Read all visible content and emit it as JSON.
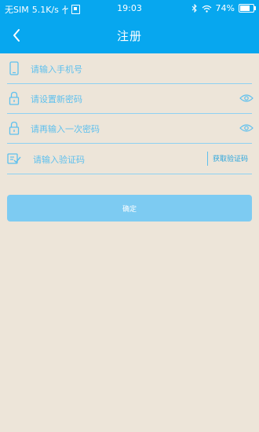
{
  "status_bar": {
    "carrier": "无SIM",
    "speed": "5.1K/s",
    "time": "19:03",
    "battery": "74%"
  },
  "nav": {
    "title": "注册"
  },
  "form": {
    "phone_placeholder": "请输入手机号",
    "password_placeholder": "请设置新密码",
    "confirm_placeholder": "请再输入一次密码",
    "code_placeholder": "请输入验证码",
    "get_code_label": "获取验证码",
    "submit_label": "确定"
  },
  "colors": {
    "header": "#07a7ef",
    "background": "#ede5d9",
    "accent": "#5ec0ee",
    "button": "#7dcbf2"
  },
  "icons": {
    "back": "back-arrow-icon",
    "phone": "phone-icon",
    "lock": "lock-icon",
    "eye": "eye-icon",
    "verify": "verify-check-icon"
  }
}
